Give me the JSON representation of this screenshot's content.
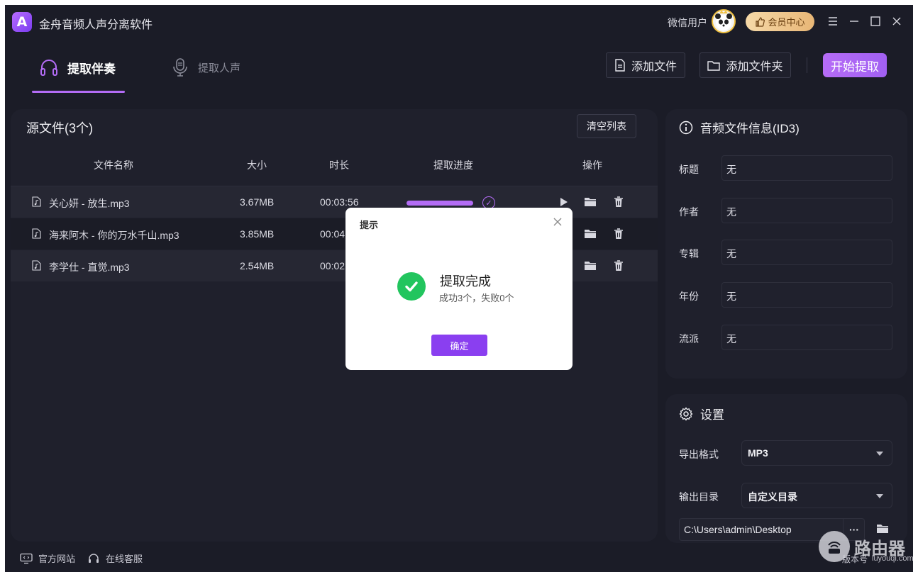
{
  "app": {
    "title": "金舟音频人声分离软件",
    "logo_letter": "A"
  },
  "titlebar": {
    "user_name": "微信用户",
    "vip_label": "会员中心"
  },
  "tabs": [
    {
      "label": "提取伴奏",
      "active": true
    },
    {
      "label": "提取人声",
      "active": false
    }
  ],
  "toolbar": {
    "add_file": "添加文件",
    "add_folder": "添加文件夹",
    "start": "开始提取"
  },
  "file_list": {
    "title": "源文件(3个)",
    "clear_label": "清空列表",
    "columns": [
      "文件名称",
      "大小",
      "时长",
      "提取进度",
      "操作"
    ],
    "rows": [
      {
        "name": "关心妍 - 放生.mp3",
        "size": "3.67MB",
        "duration": "00:03:56",
        "progress": 1.0
      },
      {
        "name": "海来阿木 - 你的万水千山.mp3",
        "size": "3.85MB",
        "duration": "00:04",
        "progress": 1.0
      },
      {
        "name": "李学仕 - 直觉.mp3",
        "size": "2.54MB",
        "duration": "00:02",
        "progress": 1.0
      }
    ]
  },
  "id3": {
    "title": "音频文件信息(ID3)",
    "fields": [
      {
        "label": "标题",
        "value": "无"
      },
      {
        "label": "作者",
        "value": "无"
      },
      {
        "label": "专辑",
        "value": "无"
      },
      {
        "label": "年份",
        "value": "无"
      },
      {
        "label": "流派",
        "value": "无"
      }
    ]
  },
  "settings": {
    "title": "设置",
    "format_label": "导出格式",
    "format_value": "MP3",
    "output_label": "输出目录",
    "output_value": "自定义目录",
    "path": "C:\\Users\\admin\\Desktop",
    "more": "···"
  },
  "footer": {
    "website": "官方网站",
    "support": "在线客服",
    "version": "版本号"
  },
  "watermark": {
    "text": "路由器",
    "sub": "luyouqi.com"
  },
  "dialog": {
    "title": "提示",
    "main": "提取完成",
    "sub": "成功3个，失败0个",
    "ok": "确定"
  },
  "colors": {
    "accent": "#b36cf5",
    "background": "#1b1c27",
    "panel": "#1f202c",
    "success": "#22c55e",
    "button_primary": "#8a3ff0"
  }
}
